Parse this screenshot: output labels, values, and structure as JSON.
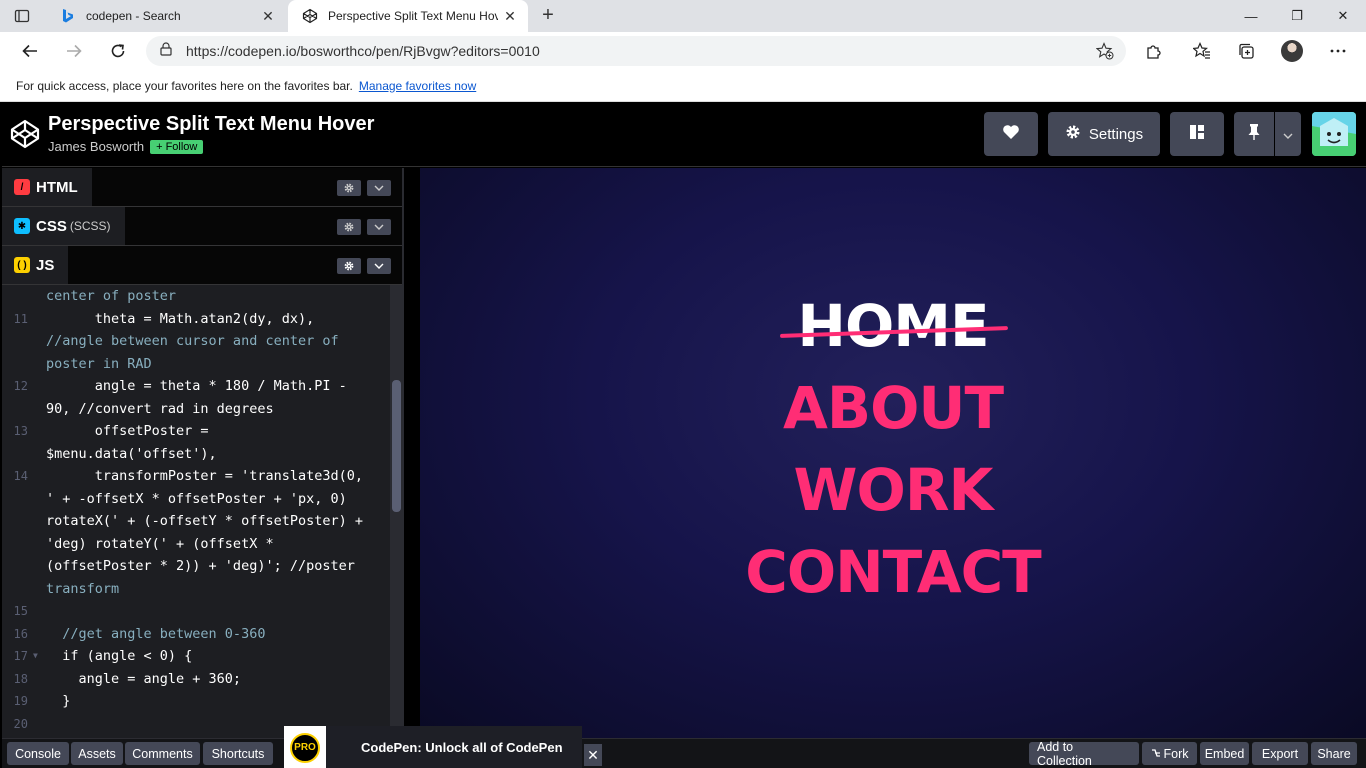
{
  "browser": {
    "tabs": [
      {
        "title": "codepen - Search",
        "active": false
      },
      {
        "title": "Perspective Split Text Menu Hove",
        "active": true
      }
    ],
    "url": "https://codepen.io/bosworthco/pen/RjBvgw?editors=0010",
    "favbar_text": "For quick access, place your favorites here on the favorites bar.",
    "favbar_link": "Manage favorites now"
  },
  "pen": {
    "title": "Perspective Split Text Menu Hover",
    "author": "James Bosworth",
    "follow_label": "+ Follow",
    "settings_label": "Settings"
  },
  "editors": {
    "html_label": "HTML",
    "css_label": "CSS",
    "css_sub": "(SCSS)",
    "js_label": "JS"
  },
  "code_lines": [
    {
      "ln": "",
      "text": "center of poster",
      "cls": "c-com"
    },
    {
      "ln": "11",
      "text": "      theta = Math.atan2(dy, dx),",
      "cls": ""
    },
    {
      "ln": "",
      "text": "//angle between cursor and center of",
      "cls": "c-com"
    },
    {
      "ln": "",
      "text": "poster in RAD",
      "cls": "c-com"
    },
    {
      "ln": "12",
      "text": "      angle = theta * 180 / Math.PI -",
      "cls": ""
    },
    {
      "ln": "",
      "text": "90, //convert rad in degrees",
      "cls": ""
    },
    {
      "ln": "13",
      "text": "      offsetPoster =",
      "cls": ""
    },
    {
      "ln": "",
      "text": "$menu.data('offset'),",
      "cls": ""
    },
    {
      "ln": "14",
      "text": "      transformPoster = 'translate3d(0,",
      "cls": ""
    },
    {
      "ln": "",
      "text": "' + -offsetX * offsetPoster + 'px, 0)",
      "cls": ""
    },
    {
      "ln": "",
      "text": "rotateX(' + (-offsetY * offsetPoster) +",
      "cls": ""
    },
    {
      "ln": "",
      "text": "'deg) rotateY(' + (offsetX *",
      "cls": ""
    },
    {
      "ln": "",
      "text": "(offsetPoster * 2)) + 'deg)'; //poster",
      "cls": ""
    },
    {
      "ln": "",
      "text": "transform",
      "cls": "c-com"
    },
    {
      "ln": "15",
      "text": "",
      "cls": ""
    },
    {
      "ln": "16",
      "text": "  //get angle between 0-360",
      "cls": "c-com"
    },
    {
      "ln": "17",
      "text": "  if (angle < 0) {",
      "cls": ""
    },
    {
      "ln": "18",
      "text": "    angle = angle + 360;",
      "cls": ""
    },
    {
      "ln": "19",
      "text": "  }",
      "cls": ""
    },
    {
      "ln": "20",
      "text": "",
      "cls": ""
    }
  ],
  "preview": {
    "menu_items": [
      "HOME",
      "ABOUT",
      "WORK",
      "CONTACT"
    ],
    "accent": "#ff2d75",
    "background": "#16144a"
  },
  "footer": {
    "left_buttons": [
      "Console",
      "Assets",
      "Comments",
      "Shortcuts"
    ],
    "promo_text": "CodePen: Unlock all of CodePen",
    "promo_badge": "PRO",
    "right_buttons": [
      "Add to Collection",
      "Fork",
      "Embed",
      "Export",
      "Share"
    ]
  }
}
